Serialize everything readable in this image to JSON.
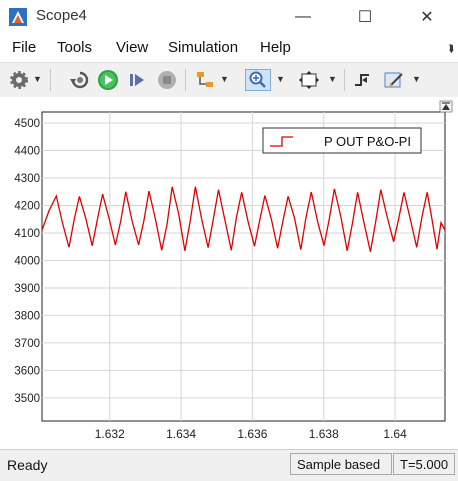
{
  "window": {
    "title": "Scope4",
    "controls": {
      "minimize": "—",
      "maximize": "☐",
      "close": "✕"
    }
  },
  "menu": {
    "items": [
      "File",
      "Tools",
      "View",
      "Simulation",
      "Help"
    ]
  },
  "toolbar": {
    "icons": [
      "gear-icon",
      "restore-icon",
      "run-icon",
      "step-forward-icon",
      "stop-icon",
      "signal-selector-icon",
      "zoom-in-icon",
      "fit-to-view-icon",
      "triggers-icon",
      "style-edit-icon"
    ]
  },
  "chart_data": {
    "type": "line",
    "series": [
      {
        "name": "P OUT P&O-PI",
        "color": "#e00000"
      }
    ],
    "xlim": [
      1.6301,
      1.6414
    ],
    "ylim": [
      3416,
      4540
    ],
    "xticks": [
      "1.632",
      "1.634",
      "1.636",
      "1.638",
      "1.64"
    ],
    "yticks": [
      "3500",
      "3600",
      "3700",
      "3800",
      "3900",
      "4000",
      "4100",
      "4200",
      "4300",
      "4400",
      "4500"
    ],
    "grid": true,
    "legend_position": "top-right",
    "signal": {
      "baseline": 4050,
      "peak": 4250,
      "peaks_x": [
        1.6305,
        1.63115,
        1.6318,
        1.63245,
        1.6331,
        1.63375,
        1.6344,
        1.63505,
        1.6357,
        1.63635,
        1.637,
        1.63765,
        1.6383,
        1.63895,
        1.6396,
        1.64025,
        1.6409
      ]
    }
  },
  "status": {
    "ready": "Ready",
    "sample_mode": "Sample based",
    "time": "T=5.000"
  }
}
